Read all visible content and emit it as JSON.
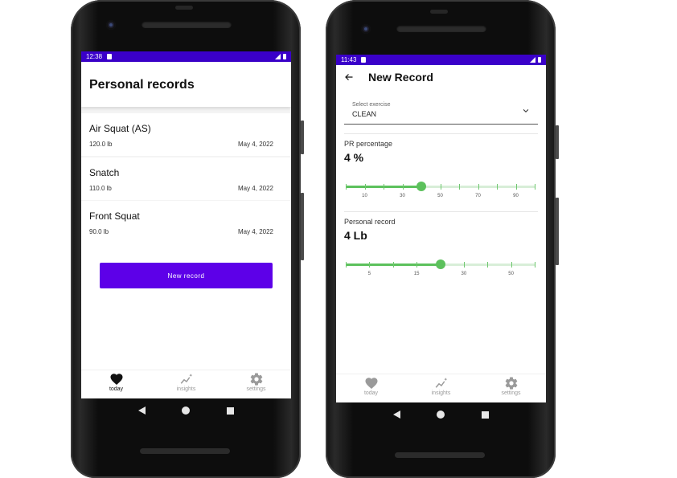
{
  "left_phone": {
    "status_time": "12:38",
    "title": "Personal records",
    "records": [
      {
        "name": "Air Squat (AS)",
        "weight": "120.0 lb",
        "date": "May 4, 2022"
      },
      {
        "name": "Snatch",
        "weight": "110.0 lb",
        "date": "May 4, 2022"
      },
      {
        "name": "Front Squat",
        "weight": "90.0 lb",
        "date": "May 4, 2022"
      }
    ],
    "new_record_button": "New record",
    "nav": {
      "today": "today",
      "insights": "insights",
      "settings": "settings",
      "active": "today"
    }
  },
  "right_phone": {
    "status_time": "11:43",
    "title": "New Record",
    "select_label": "Select exercise",
    "select_value": "CLEAN",
    "pr_label": "PR percentage",
    "pr_value": "4 %",
    "pr_slider": {
      "value_fraction": 0.4,
      "tick_labels": [
        "10",
        "30",
        "50",
        "70",
        "90"
      ]
    },
    "record_label": "Personal record",
    "record_value": "4 Lb",
    "record_slider": {
      "value_fraction": 0.5,
      "tick_labels": [
        "5",
        "15",
        "30",
        "50"
      ]
    },
    "nav": {
      "today": "today",
      "insights": "insights",
      "settings": "settings",
      "active": "none"
    }
  },
  "colors": {
    "status_bar": "#3a00c9",
    "primary_button": "#5d00e8",
    "slider_green": "#5cc15c"
  },
  "icons": {
    "today": "heart-icon",
    "insights": "sparkle-chart-icon",
    "settings": "gear-icon",
    "back": "arrow-left-icon",
    "dropdown": "chevron-down-icon"
  }
}
